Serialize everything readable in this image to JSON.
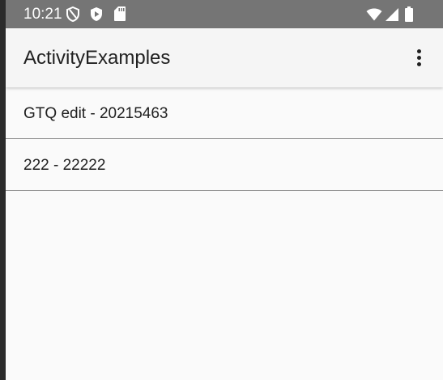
{
  "status_bar": {
    "time": "10:21",
    "left_icons": [
      "shield-outline-icon",
      "play-protect-icon",
      "sd-card-icon"
    ],
    "right_icons": [
      "wifi-icon",
      "cellular-signal-icon",
      "battery-icon"
    ]
  },
  "app_bar": {
    "title": "ActivityExamples",
    "overflow_icon": "more-vert-icon"
  },
  "list": {
    "items": [
      {
        "text": "GTQ edit - 20215463"
      },
      {
        "text": "222 - 22222"
      }
    ]
  },
  "colors": {
    "status_bar": "#757575",
    "app_bar": "#f5f5f5",
    "background": "#fafafa",
    "divider": "#8a8a8a",
    "text": "#212121"
  }
}
